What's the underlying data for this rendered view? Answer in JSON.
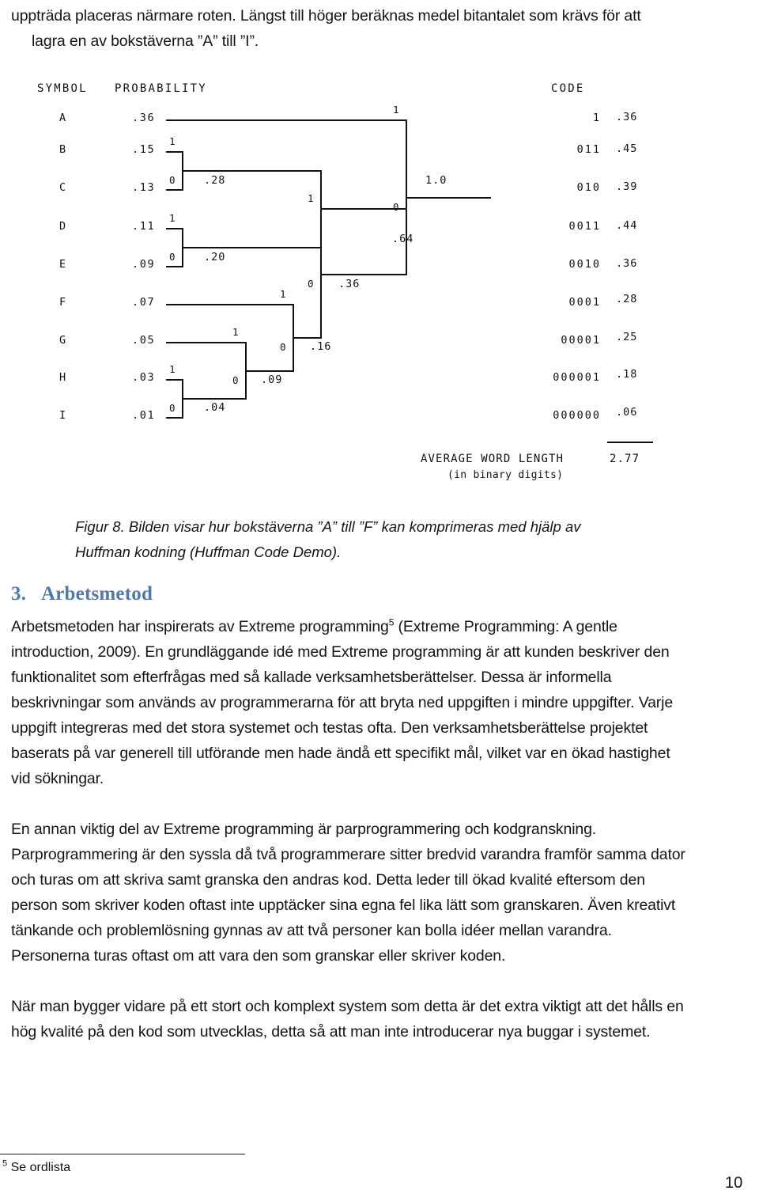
{
  "top_paragraph": {
    "line1": "uppträda placeras närmare roten. Längst till höger beräknas medel bitantalet som krävs för att",
    "line2": "lagra en av bokstäverna ”A” till ”I”."
  },
  "figure": {
    "header_symbol": "SYMBOL",
    "header_probability": "PROBABILITY",
    "header_code": "CODE",
    "rows": [
      {
        "symbol": "A",
        "probability": ".36",
        "code": "1",
        "contribution": ".36"
      },
      {
        "symbol": "B",
        "probability": ".15",
        "code": "011",
        "contribution": ".45"
      },
      {
        "symbol": "C",
        "probability": ".13",
        "code": "010",
        "contribution": ".39"
      },
      {
        "symbol": "D",
        "probability": ".11",
        "code": "0011",
        "contribution": ".44"
      },
      {
        "symbol": "E",
        "probability": ".09",
        "code": "0010",
        "contribution": ".36"
      },
      {
        "symbol": "F",
        "probability": ".07",
        "code": "0001",
        "contribution": ".28"
      },
      {
        "symbol": "G",
        "probability": ".05",
        "code": "00001",
        "contribution": ".25"
      },
      {
        "symbol": "H",
        "probability": ".03",
        "code": "000001",
        "contribution": ".18"
      },
      {
        "symbol": "I",
        "probability": ".01",
        "code": "000000",
        "contribution": ".06"
      }
    ],
    "internal_nodes": [
      {
        "label": ".28",
        "bit_top": "1",
        "bit_bottom": "0"
      },
      {
        "label": ".20",
        "bit_top": "1",
        "bit_bottom": "0"
      },
      {
        "label": ".04",
        "bit_top": "1",
        "bit_bottom": "0"
      },
      {
        "label": ".09",
        "bit_top": "1",
        "bit_bottom": "0"
      },
      {
        "label": ".16",
        "bit_top": "1",
        "bit_bottom": "0"
      },
      {
        "label": ".36",
        "bit_top": "1",
        "bit_bottom": "0"
      },
      {
        "label": ".64",
        "bit_top": "1",
        "bit_bottom": "0"
      },
      {
        "label": "1.0",
        "bit_top": "1",
        "bit_bottom": "0"
      }
    ],
    "average_word_length_label": "AVERAGE WORD LENGTH",
    "average_word_length_value": "2.77",
    "average_word_length_units": "(in binary digits)"
  },
  "chart_data": {
    "type": "diagram",
    "title": "Huffman code tree",
    "categories": [
      "A",
      "B",
      "C",
      "D",
      "E",
      "F",
      "G",
      "H",
      "I"
    ],
    "values": [
      0.36,
      0.15,
      0.13,
      0.11,
      0.09,
      0.07,
      0.05,
      0.03,
      0.01
    ],
    "codes": [
      "1",
      "011",
      "010",
      "0011",
      "0010",
      "0001",
      "00001",
      "000001",
      "000000"
    ],
    "contributions": [
      0.36,
      0.45,
      0.39,
      0.44,
      0.36,
      0.28,
      0.25,
      0.18,
      0.06
    ],
    "merge_totals": [
      0.28,
      0.2,
      0.04,
      0.09,
      0.16,
      0.36,
      0.64,
      1.0
    ],
    "average_word_length": 2.77,
    "xlabel": "",
    "ylabel": ""
  },
  "caption": {
    "line1": "Figur 8. Bilden visar hur bokstäverna ”A” till ”F” kan komprimeras med hjälp av",
    "line2": "Huffman kodning (Huffman Code Demo)."
  },
  "heading": {
    "number": "3.",
    "title": "Arbetsmetod",
    "color": "#4e79b2"
  },
  "body": {
    "p1_l1_a": "Arbetsmetoden har inspirerats av Extreme programming",
    "p1_l1_sup": "5",
    "p1_l1_b": " (Extreme Programming: A gentle",
    "p1_l2": "introduction, 2009). En grundläggande idé med Extreme programming är att kunden beskriver den",
    "p1_l3": "funktionalitet som efterfrågas med så kallade verksamhetsberättelser. Dessa är informella",
    "p1_l4": "beskrivningar som används av programmerarna för att bryta ned uppgiften i mindre uppgifter. Varje",
    "p1_l5": "uppgift integreras med det stora systemet och testas ofta. Den verksamhetsberättelse projektet",
    "p1_l6": "baserats på var generell till utförande men hade ändå ett specifikt mål, vilket var en ökad hastighet",
    "p1_l7": "vid sökningar.",
    "p2_l1": "En annan viktig del av Extreme programming är parprogrammering och kodgranskning.",
    "p2_l2": "Parprogrammering är den syssla då två programmerare sitter bredvid varandra framför samma dator",
    "p2_l3": "och turas om att skriva samt granska den andras kod. Detta leder till ökad kvalité eftersom den",
    "p2_l4": "person som skriver koden oftast inte upptäcker sina egna fel lika lätt som granskaren. Även kreativt",
    "p2_l5": "tänkande och problemlösning gynnas av att två personer kan bolla idéer mellan varandra.",
    "p2_l6": "Personerna turas oftast om att vara den som granskar eller skriver koden.",
    "p3_l1": "När man bygger vidare på ett stort och komplext system som detta är det extra viktigt att det hålls en",
    "p3_l2": "hög kvalité på den kod som utvecklas, detta så att man inte introducerar nya buggar i systemet."
  },
  "footnote": {
    "marker": "5",
    "text": " Se ordlista"
  },
  "page_number": "10"
}
